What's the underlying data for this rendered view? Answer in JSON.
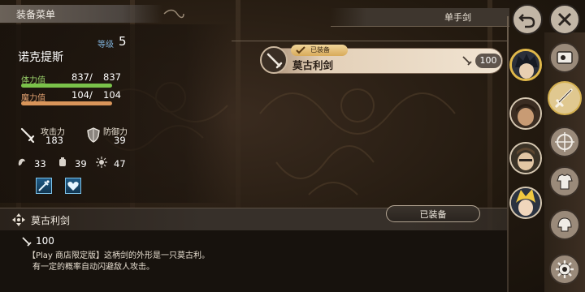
{
  "header": {
    "title": "装备菜单"
  },
  "character": {
    "name": "诺克提斯",
    "level_label": "等级",
    "level": "5",
    "hp": {
      "label": "体力值",
      "current": "837/",
      "max": "837",
      "fill": 1.0,
      "color": "#7ac24a"
    },
    "mp": {
      "label": "魔力值",
      "current": "104/",
      "max": "104",
      "fill": 1.0,
      "color": "#d9955a"
    },
    "attack": {
      "label": "攻击力",
      "value": "183"
    },
    "defense": {
      "label": "防御力",
      "value": "39"
    },
    "sub_stats": [
      {
        "icon": "strength-icon",
        "value": "33"
      },
      {
        "icon": "vitality-icon",
        "value": "39"
      },
      {
        "icon": "spirit-icon",
        "value": "47"
      }
    ]
  },
  "weapon_list": {
    "category": "单手剑",
    "items": [
      {
        "name": "莫古利剑",
        "tag": "已装备",
        "value": "100"
      }
    ]
  },
  "detail": {
    "name": "莫古利剑",
    "equipped_button": "已装备",
    "value": "100",
    "desc_line1": "【Play 商店限定版】这柄剑的外形是一只莫古利。",
    "desc_line2": "有一定的概率自动闪避敌人攻击。"
  },
  "colors": {
    "accent": "#e0b84a",
    "skill_blue": "#7ec4ea"
  }
}
